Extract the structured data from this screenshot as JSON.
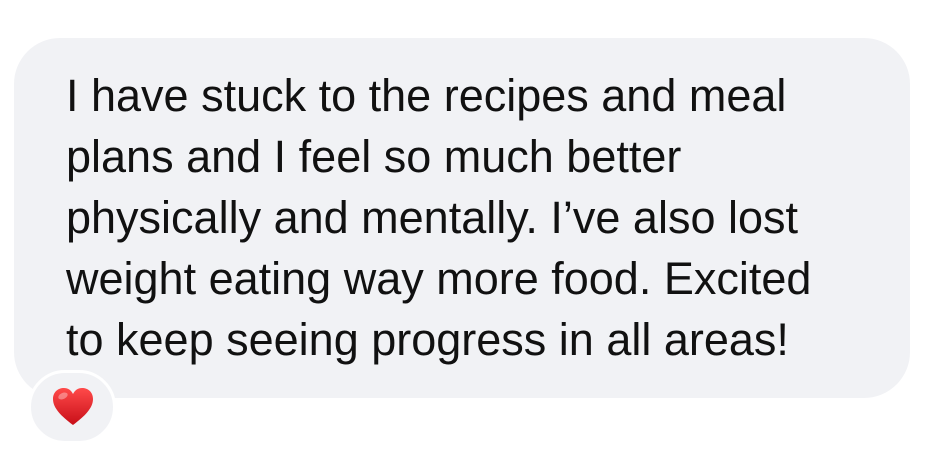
{
  "message": {
    "lines": [
      "I have stuck to the recipes and meal",
      "plans and I feel so much better",
      "physically and mentally. I’ve also lost",
      "weight eating way more food. Excited",
      "to keep seeing progress in all areas!"
    ]
  },
  "reaction": {
    "icon": "heart-icon",
    "color": "#e0151f"
  },
  "colors": {
    "bubble": "#f1f2f5",
    "text": "#111111",
    "background": "#ffffff"
  }
}
